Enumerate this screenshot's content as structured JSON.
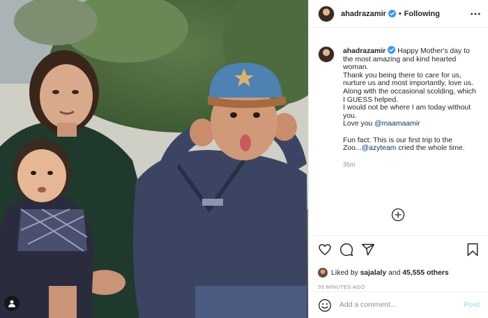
{
  "post": {
    "author": "ahadrazamir",
    "follow_status": "Following",
    "header_separator": "•",
    "caption": {
      "author": "ahadrazamir",
      "text_part1": "Happy Mother's day to the most amazing and kind hearted woman.\nThank you being there to care for us, nurture us and most importantly, love us.\nAlong with the occasional scolding, which I GUESS helped.\nI would not be where I am today without you.\nLove you ",
      "mention1": "@maamaamir",
      "text_part2": "\n\nFun fact: This is our first trip to the Zoo...",
      "mention2": "@azyteam",
      "text_part3": " cried the whole time."
    },
    "caption_time": "35m",
    "likes": {
      "prefix": "Liked by",
      "user": "sajalaly",
      "conjunction": "and",
      "count": "45,555 others"
    },
    "posted_ago": "35 MINUTES AGO"
  },
  "comment": {
    "placeholder": "Add a comment...",
    "post_label": "Post"
  },
  "icons": {
    "header_more": "more-options-icon",
    "verified": "verified-badge-icon",
    "like": "heart-icon",
    "comment": "comment-icon",
    "share": "share-icon",
    "save": "bookmark-icon",
    "emoji": "emoji-icon",
    "load_more": "plus-circle-icon",
    "tag": "user-tag-icon"
  },
  "colors": {
    "verified": "#3897f0",
    "mention": "#00376b",
    "post_button": "#b2dffc",
    "muted": "#8e8e8e"
  }
}
